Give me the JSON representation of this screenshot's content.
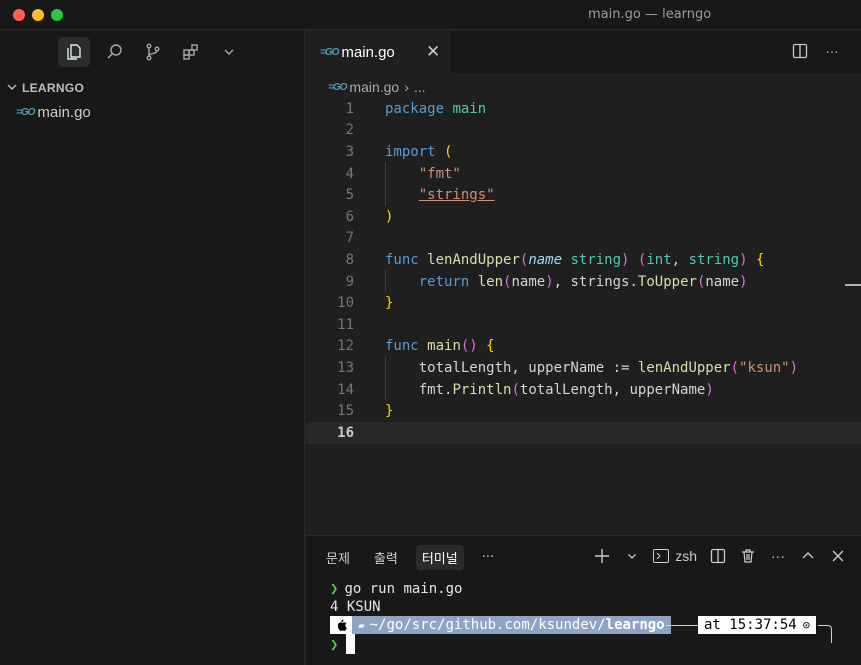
{
  "window": {
    "title": "main.go — learngo"
  },
  "sidebar": {
    "folder_name": "LEARNGO",
    "files": [
      {
        "name": "main.go",
        "icon": "go-file-icon"
      }
    ]
  },
  "editor": {
    "tab": {
      "label": "main.go",
      "close": "✕"
    },
    "breadcrumb": {
      "file": "main.go",
      "more": "..."
    },
    "current_line": 16,
    "lines": [
      {
        "n": "1"
      },
      {
        "n": "2"
      },
      {
        "n": "3"
      },
      {
        "n": "4"
      },
      {
        "n": "5"
      },
      {
        "n": "6"
      },
      {
        "n": "7"
      },
      {
        "n": "8"
      },
      {
        "n": "9"
      },
      {
        "n": "10"
      },
      {
        "n": "11"
      },
      {
        "n": "12"
      },
      {
        "n": "13"
      },
      {
        "n": "14"
      },
      {
        "n": "15"
      },
      {
        "n": "16"
      }
    ],
    "code": {
      "l1_kw": "package",
      "l1_name": "main",
      "l3_kw": "import",
      "l3_paren": "(",
      "l4": "\"fmt\"",
      "l5": "\"strings\"",
      "l6": ")",
      "l8_kw": "func",
      "l8_fn": "lenAndUpper",
      "l8_param": "name",
      "l8_ptype": "string",
      "l8_ret1": "int",
      "l8_ret2": "string",
      "l8_brace": "{",
      "l9_kw": "return",
      "l9_len": "len",
      "l9_arg": "name",
      "l9_pkg": "strings.",
      "l9_fn": "ToUpper",
      "l9_arg2": "name",
      "l10": "}",
      "l12_kw": "func",
      "l12_fn": "main",
      "l12_rest": "()",
      "l12_brace": "{",
      "l13_vars": "totalLength, upperName := ",
      "l13_fn": "lenAndUpper",
      "l13_str": "\"ksun\"",
      "l14_pkg": "fmt.",
      "l14_fn": "Println",
      "l14_args": "totalLength, upperName",
      "l15": "}"
    }
  },
  "panel": {
    "tabs": [
      "문제",
      "출력",
      "터미널",
      "···"
    ],
    "active_tab": "터미널",
    "shell": "zsh",
    "terminal": {
      "cmd_prompt": "❯",
      "cmd": "go run main.go",
      "output": "4 KSUN",
      "path_prefix": "~/go/src/github.com/ksundev/",
      "path_bold": "learngo",
      "time": "at 15:37:54",
      "prompt2": "❯"
    }
  },
  "colors": {
    "accent": "#0078d4",
    "bg": "#1f1f1f",
    "sidebar_bg": "#181818"
  }
}
